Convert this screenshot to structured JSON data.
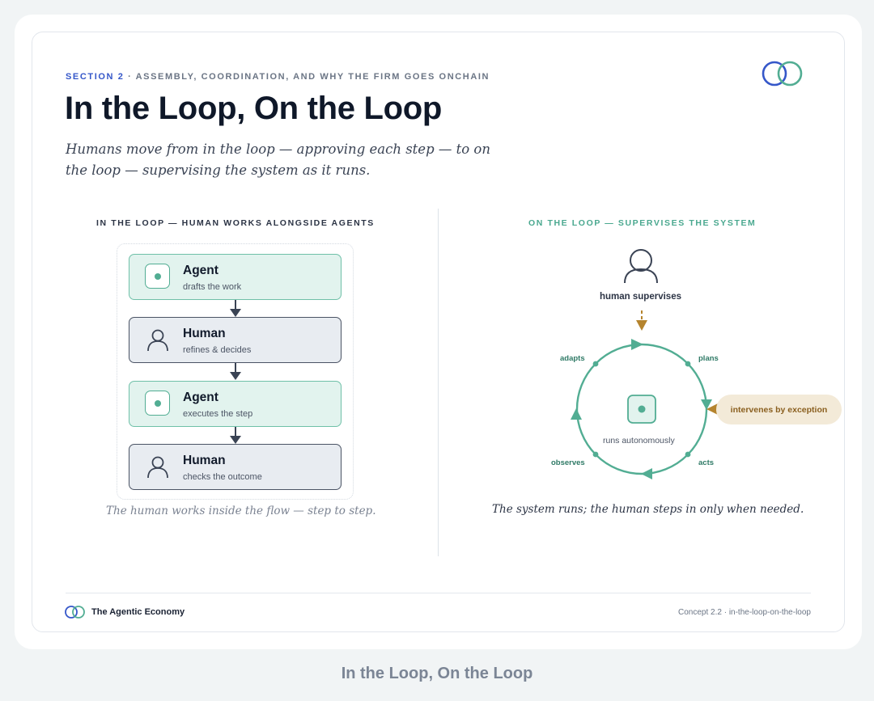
{
  "header": {
    "section_label": "SECTION 2",
    "section_separator": " · ",
    "section_topic": "ASSEMBLY, COORDINATION, AND WHY THE FIRM GOES ONCHAIN",
    "title": "In the Loop, On the Loop",
    "subtitle": "Humans move from in the loop — approving each step — to on the loop — supervising the system as it runs."
  },
  "left_panel": {
    "heading": "IN THE LOOP — HUMAN WORKS ALONGSIDE AGENTS",
    "steps": [
      {
        "name": "Agent",
        "desc": "drafts the work",
        "icon": "agent-icon"
      },
      {
        "name": "Human",
        "desc": "refines & decides",
        "icon": "person-icon"
      },
      {
        "name": "Agent",
        "desc": "executes the step",
        "icon": "agent-icon"
      },
      {
        "name": "Human",
        "desc": "checks the outcome",
        "icon": "person-icon"
      }
    ],
    "caption": "The human works inside the flow — step to step."
  },
  "right_panel": {
    "heading": "ON THE LOOP — SUPERVISES THE SYSTEM",
    "supervisor_label": "human supervises",
    "loop_nodes": {
      "adapts": "adapts",
      "plans": "plans",
      "observes": "observes",
      "acts": "acts"
    },
    "core_label": "runs autonomously",
    "intervene_label": "intervenes by exception",
    "caption": "The system runs; the human steps in only when needed."
  },
  "footer": {
    "brand": "The Agentic Economy",
    "concept": "Concept 2.2 · in-the-loop-on-the-loop"
  },
  "page_caption": "In the Loop, On the Loop",
  "colors": {
    "accent_blue": "#3557c9",
    "accent_teal": "#52ad93",
    "agent_fill": "#e2f3ee",
    "human_fill": "#e8ecf1",
    "intervene_gold": "#b5842e",
    "pill_fill": "#f3ead8",
    "ink": "#0f1829"
  }
}
